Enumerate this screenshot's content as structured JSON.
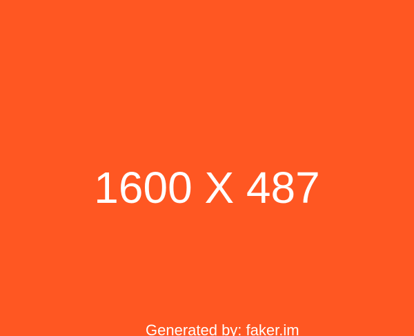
{
  "image": {
    "background_color": "#FF5722",
    "text_color": "#FFFFFF",
    "dimensions_text": "1600 X 487",
    "credit_text": "Generated by: faker.im"
  }
}
